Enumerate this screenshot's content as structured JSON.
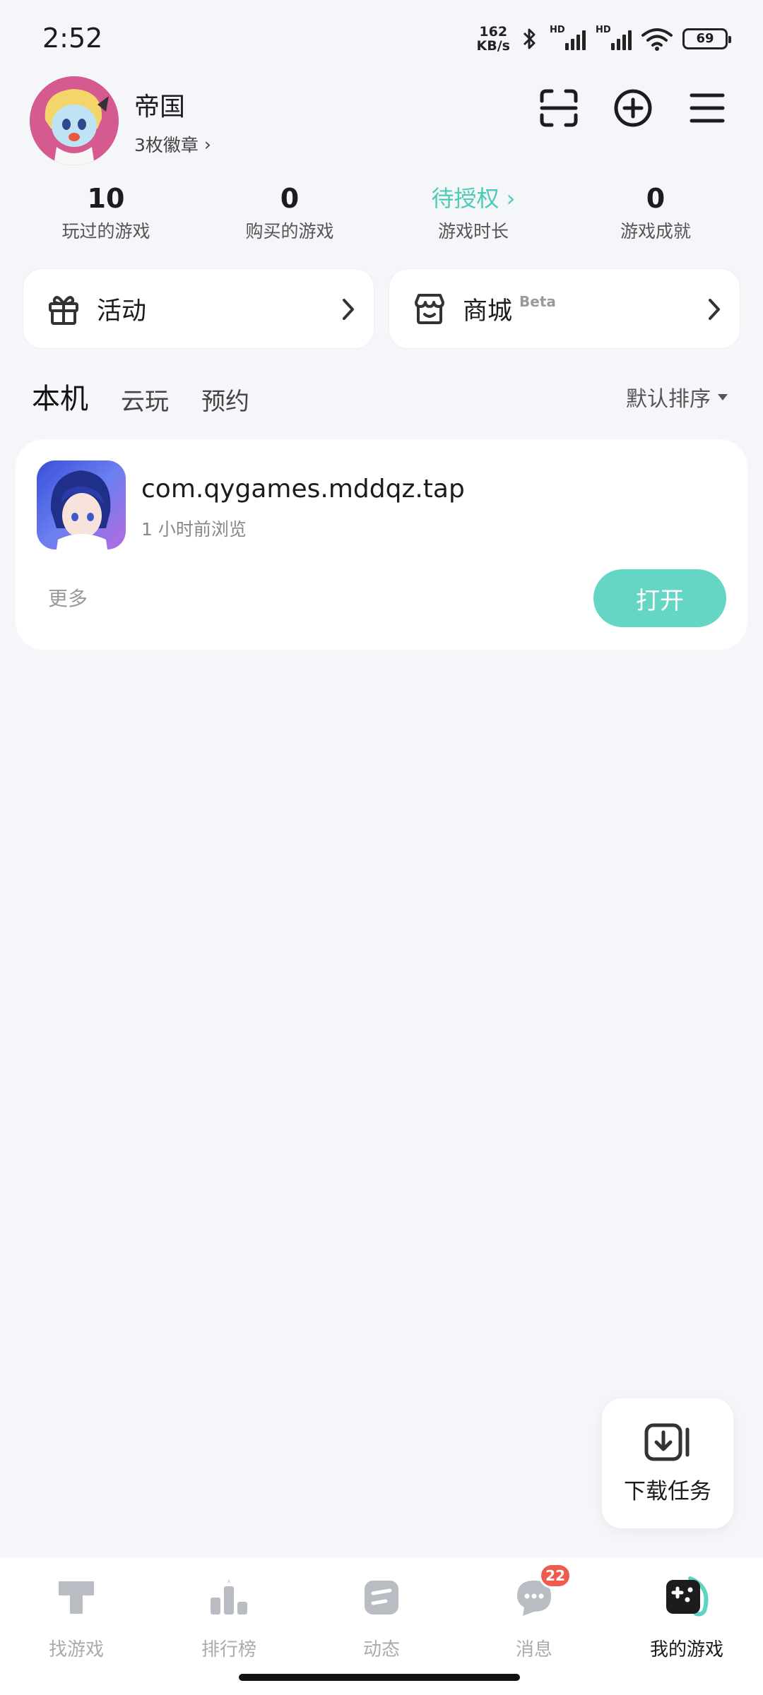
{
  "status_bar": {
    "time": "2:52",
    "net_speed_value": "162",
    "net_speed_unit": "KB/s",
    "sim1_label": "HD",
    "sim2_label": "HD",
    "battery": "69"
  },
  "profile": {
    "name": "帝国",
    "badges": "3枚徽章",
    "badges_chevron": "›"
  },
  "stats": [
    {
      "value": "10",
      "label": "玩过的游戏"
    },
    {
      "value": "0",
      "label": "购买的游戏"
    },
    {
      "value": "待授权 ›",
      "label": "游戏时长"
    },
    {
      "value": "0",
      "label": "游戏成就"
    }
  ],
  "cards": {
    "activity": {
      "label": "活动"
    },
    "store": {
      "label": "商城",
      "tag": "Beta"
    }
  },
  "tabs": [
    {
      "label": "本机",
      "active": true
    },
    {
      "label": "云玩",
      "active": false
    },
    {
      "label": "预约",
      "active": false
    }
  ],
  "sort": {
    "label": "默认排序"
  },
  "game": {
    "name": "com.qygames.mddqz.tap",
    "last_viewed": "1 小时前浏览",
    "more": "更多",
    "open": "打开"
  },
  "download_tasks": {
    "label": "下载任务"
  },
  "bottom_nav": [
    {
      "label": "找游戏",
      "icon": "find-games-icon"
    },
    {
      "label": "排行榜",
      "icon": "ranking-icon"
    },
    {
      "label": "动态",
      "icon": "feed-icon"
    },
    {
      "label": "消息",
      "icon": "messages-icon",
      "badge": "22"
    },
    {
      "label": "我的游戏",
      "icon": "my-games-icon",
      "active": true
    }
  ],
  "colors": {
    "accent": "#5fd5c1",
    "button": "#66d6c4",
    "badge": "#f05a4f",
    "background": "#f5f6f9"
  }
}
